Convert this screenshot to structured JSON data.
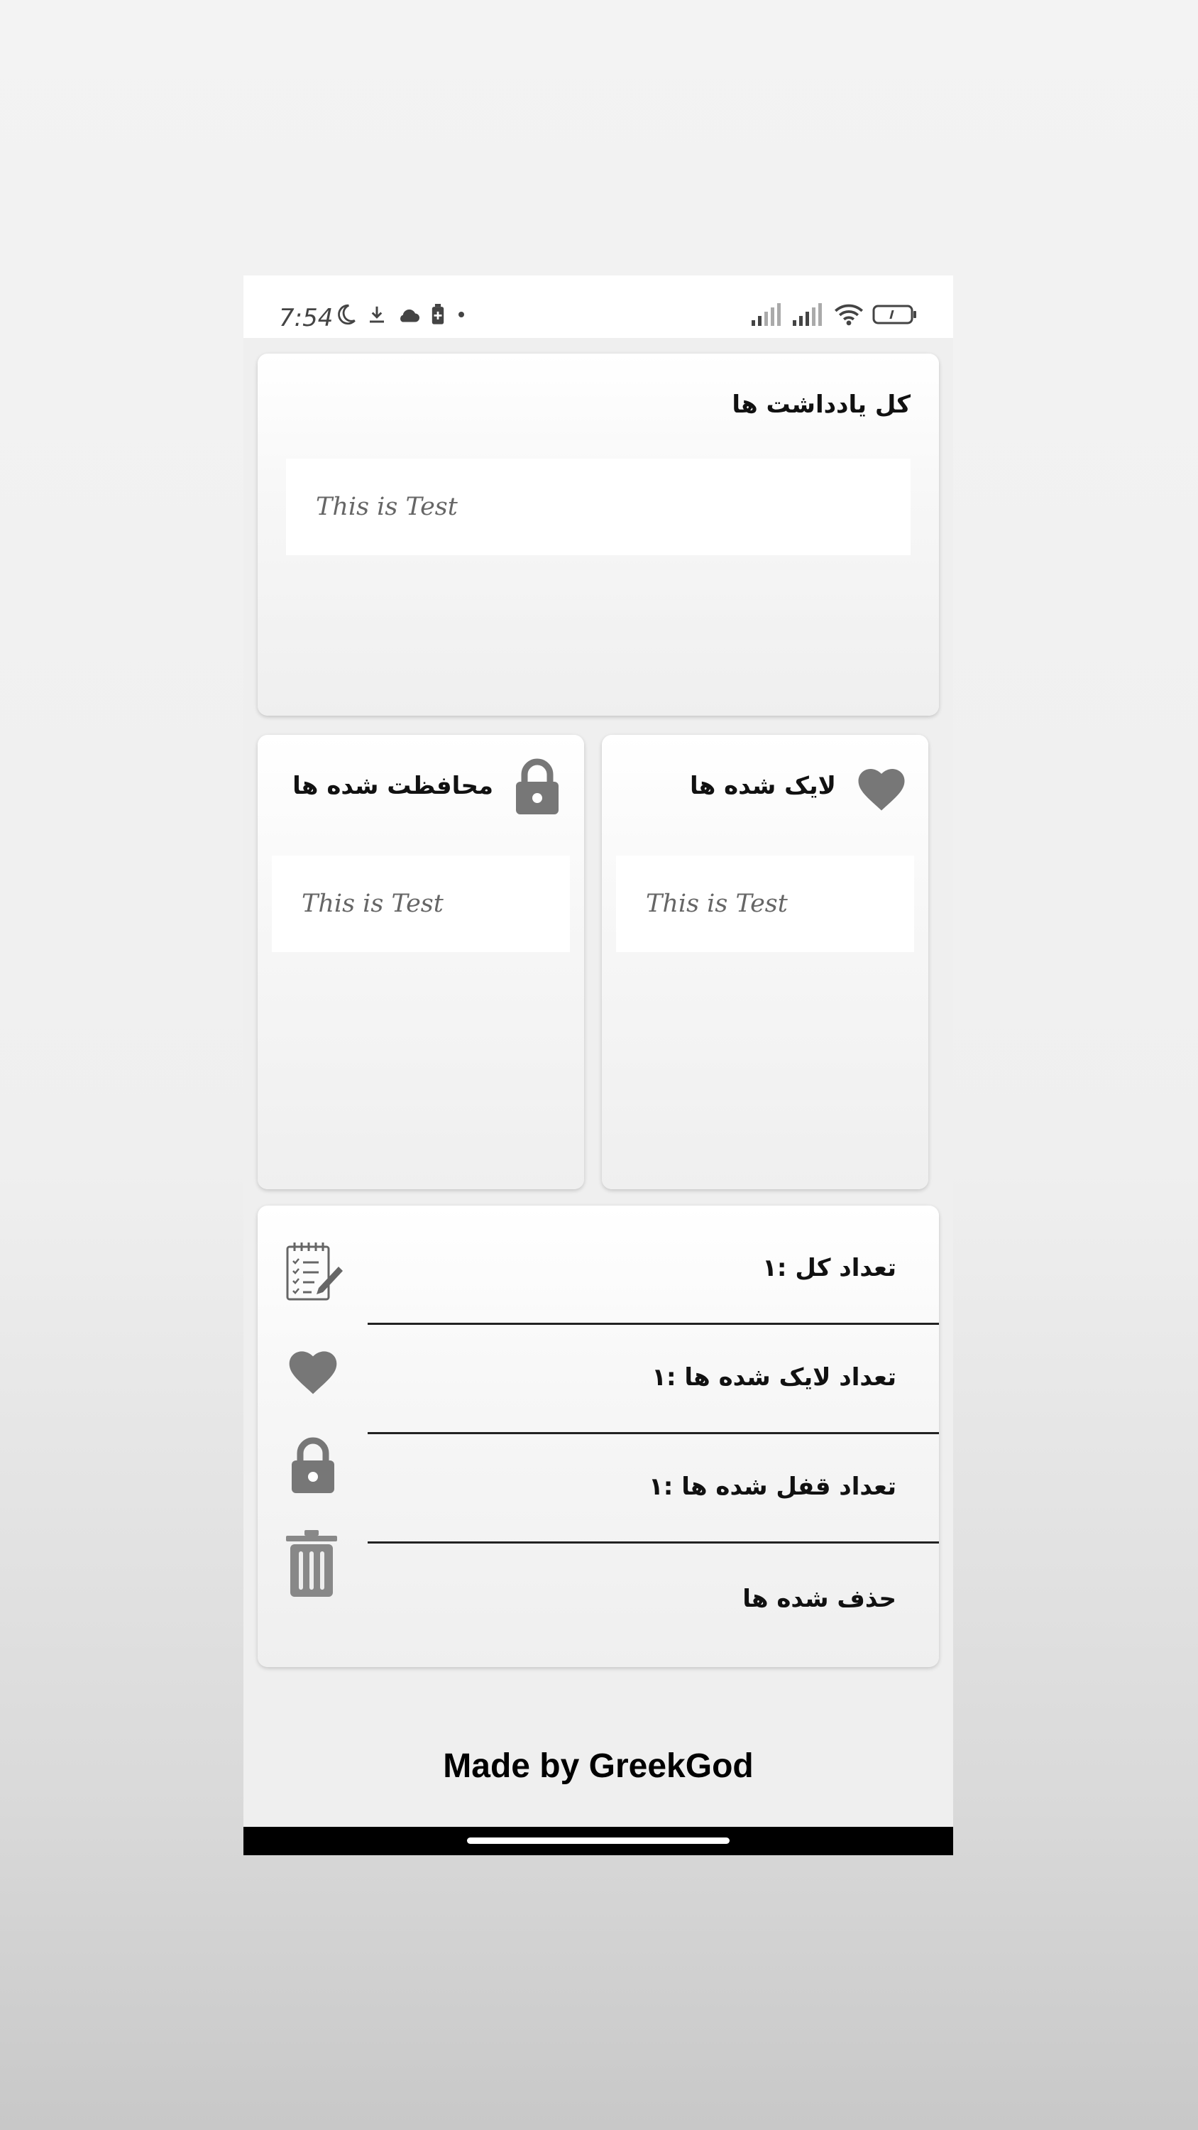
{
  "status_bar": {
    "time": "7:54",
    "left_icons": [
      "moon-icon",
      "download-icon",
      "cloud-icon",
      "battery-saver-icon",
      "dot-icon"
    ],
    "right_icons": [
      "signal-icon",
      "signal-icon",
      "wifi-icon",
      "battery-icon"
    ]
  },
  "all_notes": {
    "title": "کل یادداشت ها",
    "notes": [
      "This is Test"
    ]
  },
  "liked": {
    "title": "لایک شده ها",
    "icon": "heart-icon",
    "notes": [
      "This is Test"
    ]
  },
  "protected": {
    "title": "محافظت شده ها",
    "icon": "lock-icon",
    "notes": [
      "This is Test"
    ]
  },
  "stats": {
    "total": "تعداد کل :۱",
    "liked_count": "تعداد لایک شده ها :۱",
    "locked_count": "تعداد قفل شده ها :۱",
    "deleted": "حذف شده ها"
  },
  "footer": "Made by GreekGod",
  "colors": {
    "icon_gray": "#777777",
    "card_bg": "#ffffff",
    "page_bg": "#efefef"
  }
}
